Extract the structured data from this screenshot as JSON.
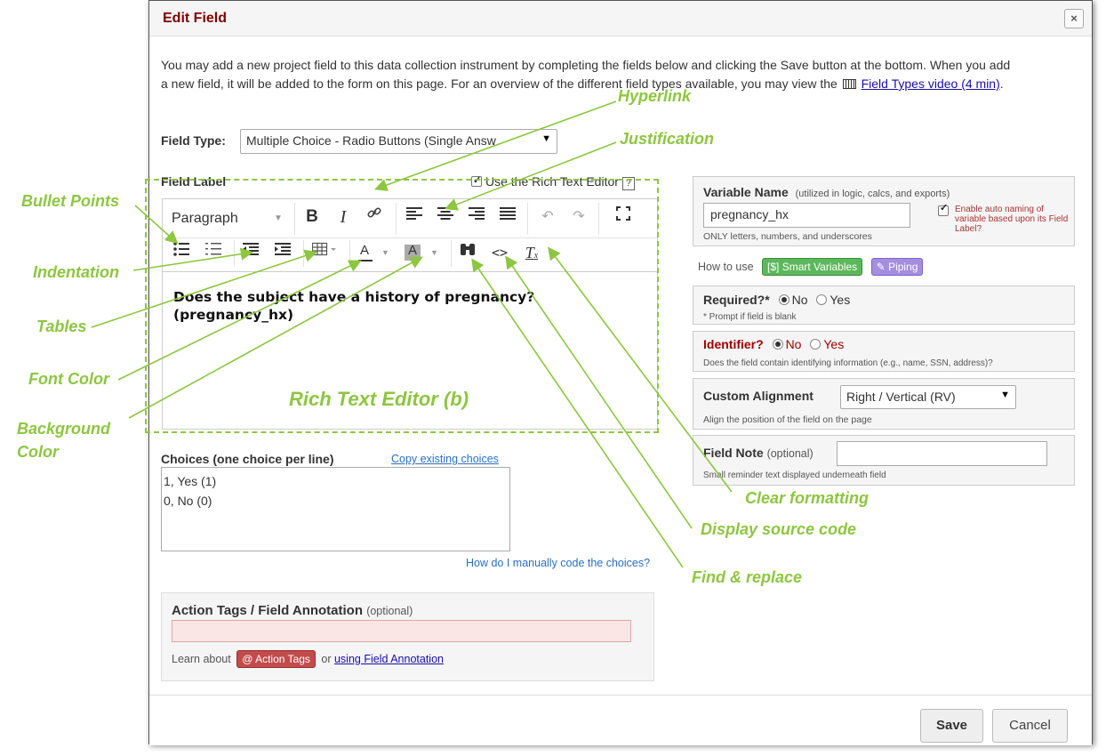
{
  "dialog": {
    "title": "Edit Field",
    "close_icon": "×",
    "intro_text_1": "You may add a new project field to this data collection instrument by completing the fields below and clicking the Save button at the bottom. When you add a new field, it will be added to the form on this page. For an overview of the different field types available, you may view the",
    "video_icon": "film-icon",
    "video_link": "Field Types video (4 min)",
    "intro_text_end": "."
  },
  "field_type": {
    "label": "Field Type:",
    "value": "Multiple Choice - Radio Buttons (Single Answ"
  },
  "field_label": {
    "label": "Field Label",
    "rich_text_toggle": "Use the Rich Text Editor",
    "rich_text_checked": true,
    "help": "?"
  },
  "editor": {
    "format_select": "Paragraph",
    "bold": "B",
    "italic": "I",
    "content_line1": "Does the subject have a history of pregnancy?",
    "content_line2": "(pregnancy_hx)"
  },
  "choices": {
    "label": "Choices (one choice per line)",
    "copy_link": "Copy existing choices",
    "lines": [
      "1, Yes (1)",
      "0, No (0)"
    ],
    "manual_link": "How do I manually code the choices?"
  },
  "action_tags": {
    "title_a": "Action Tags",
    "title_sep": " / ",
    "title_b": "Field Annotation",
    "optional": "(optional)",
    "learn_prefix": "Learn about",
    "badge": "@ Action Tags",
    "or": "or",
    "annotation_link": "using Field Annotation"
  },
  "variable_name": {
    "title": "Variable Name",
    "hint": "(utilized in logic, calcs, and exports)",
    "value": "pregnancy_hx",
    "note": "ONLY letters, numbers, and underscores",
    "auto_naming": "Enable auto naming of variable based upon its Field Label?",
    "auto_naming_checked": true
  },
  "how_to_use": {
    "label": "How to use",
    "smart_variables": "[$] Smart Variables",
    "piping": "Piping"
  },
  "required": {
    "title": "Required?*",
    "no": "No",
    "yes": "Yes",
    "selected": "No",
    "note": "* Prompt if field is blank"
  },
  "identifier": {
    "title": "Identifier?",
    "no": "No",
    "yes": "Yes",
    "selected": "No",
    "note": "Does the field contain identifying information (e.g., name, SSN, address)?"
  },
  "custom_alignment": {
    "title": "Custom Alignment",
    "value": "Right / Vertical (RV)",
    "note": "Align the position of the field on the page"
  },
  "field_note": {
    "title": "Field Note",
    "optional": "(optional)",
    "value": "",
    "note": "Small reminder text displayed underneath field"
  },
  "footer": {
    "save": "Save",
    "cancel": "Cancel"
  },
  "annotations": {
    "hyperlink": "Hyperlink",
    "justification": "Justification",
    "bullet_points": "Bullet Points",
    "indentation": "Indentation",
    "tables": "Tables",
    "font_color": "Font Color",
    "background_color_1": "Background",
    "background_color_2": "Color",
    "rich_text_editor": "Rich Text Editor (b)",
    "clear_formatting": "Clear formatting",
    "display_source_code": "Display source code",
    "find_replace": "Find & replace"
  },
  "colors": {
    "title": "#800000",
    "annotation": "#8dc63f",
    "smart_variables": "#5cb85c",
    "piping": "#a58de0",
    "action_tag": "#c24b4b"
  }
}
